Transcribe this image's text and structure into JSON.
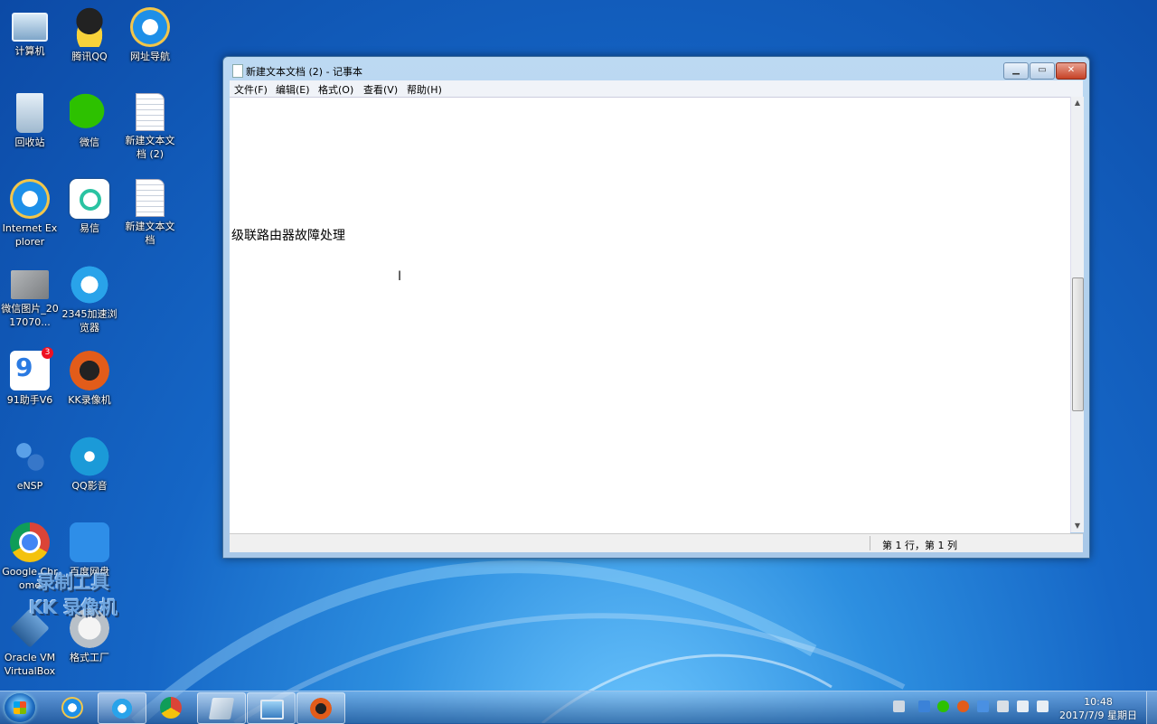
{
  "desktop": {
    "icons": [
      {
        "label": "计算机",
        "icon": "computer-icon"
      },
      {
        "label": "腾讯QQ",
        "icon": "qq-icon"
      },
      {
        "label": "网址导航",
        "icon": "ie-icon"
      },
      {
        "label": "回收站",
        "icon": "recycle-bin-icon"
      },
      {
        "label": "微信",
        "icon": "wechat-icon"
      },
      {
        "label": "新建文本文档 (2)",
        "icon": "text-file-icon"
      },
      {
        "label": "Internet Explorer",
        "icon": "ie-icon"
      },
      {
        "label": "易信",
        "icon": "yixin-icon"
      },
      {
        "label": "新建文本文档",
        "icon": "text-file-icon"
      },
      {
        "label": "微信图片_2017070...",
        "icon": "image-file-icon"
      },
      {
        "label": "2345加速浏览器",
        "icon": "browser-2345-icon"
      },
      {
        "label": "91助手V6",
        "icon": "assistant-91-icon",
        "badge": "3"
      },
      {
        "label": "KK录像机",
        "icon": "kk-recorder-icon"
      },
      {
        "label": "eNSP",
        "icon": "ensp-icon"
      },
      {
        "label": "QQ影音",
        "icon": "qq-player-icon"
      },
      {
        "label": "Google Chrome",
        "icon": "chrome-icon"
      },
      {
        "label": "百度网盘",
        "icon": "baidu-netdisk-icon"
      },
      {
        "label": "Oracle VM VirtualBox",
        "icon": "virtualbox-icon"
      },
      {
        "label": "格式工厂",
        "icon": "format-factory-icon"
      }
    ],
    "watermark": {
      "line1": "录制工具",
      "line2": "KK 录像机"
    }
  },
  "notepad": {
    "title": "新建文本文档 (2) - 记事本",
    "menu": [
      "文件(F)",
      "编辑(E)",
      "格式(O)",
      "查看(V)",
      "帮助(H)"
    ],
    "content": "级联路由器故障处理",
    "status": "第 1 行，第 1 列"
  },
  "taskbar": {
    "apps": [
      "internet-explorer",
      "browser-2345",
      "chrome",
      "notepad",
      "picture-viewer",
      "kk-recorder"
    ],
    "clock_time": "10:48",
    "clock_date": "2017/7/9 星期日"
  },
  "colors": {
    "desktop_blue": "#1566c6",
    "window_frame": "#bcd9f2",
    "close_red": "#c64226"
  }
}
